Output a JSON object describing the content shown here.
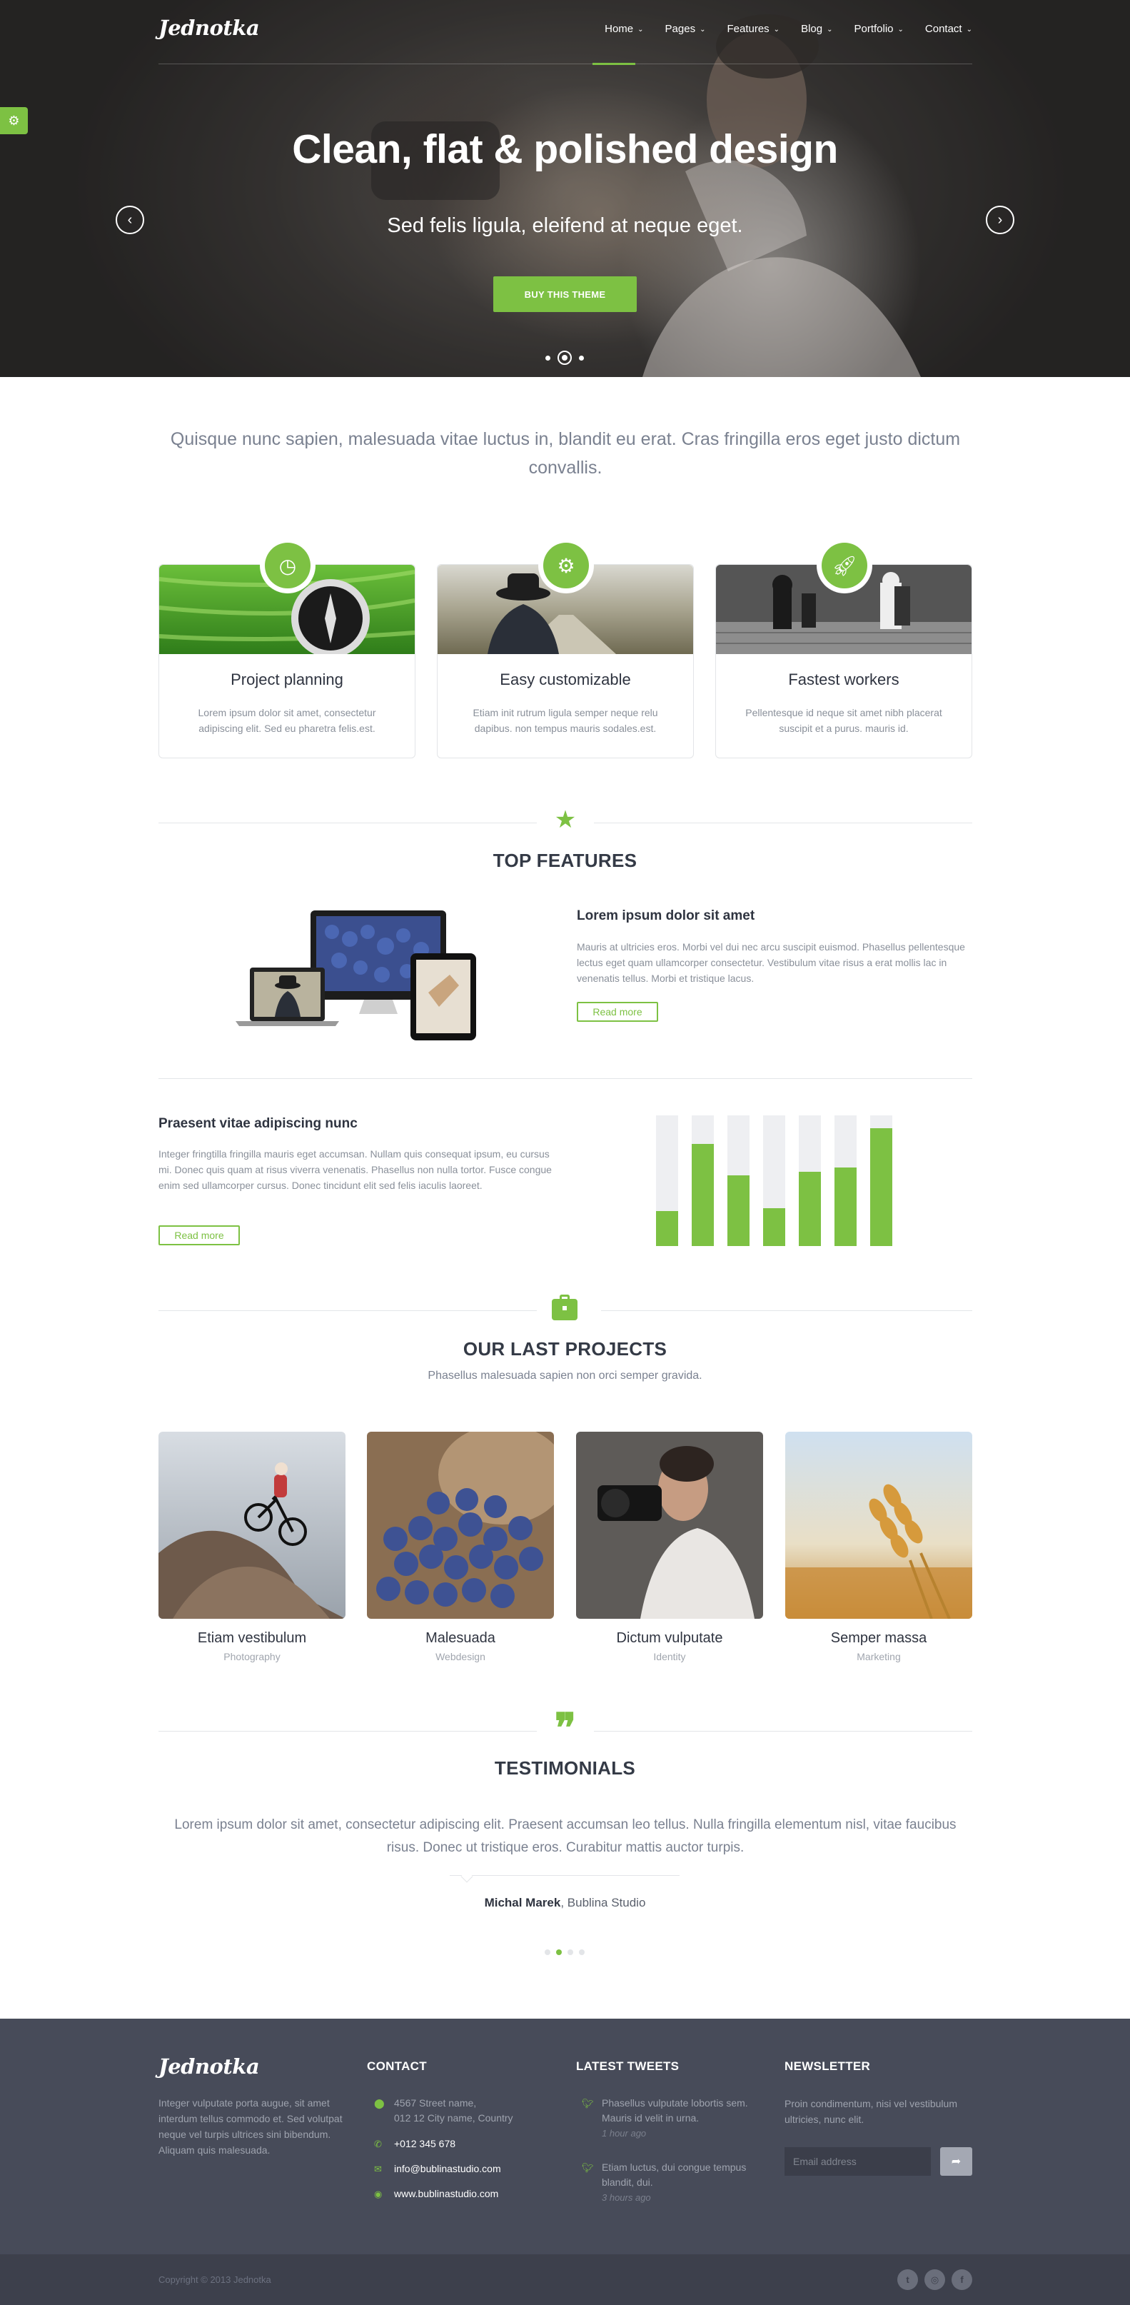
{
  "brand": {
    "logo_text": "Jednotka"
  },
  "nav": {
    "items": [
      {
        "label": "Home"
      },
      {
        "label": "Pages"
      },
      {
        "label": "Features"
      },
      {
        "label": "Blog"
      },
      {
        "label": "Portfolio"
      },
      {
        "label": "Contact"
      }
    ],
    "active_index": 0
  },
  "hero": {
    "title": "Clean, flat & polished design",
    "subtitle": "Sed felis ligula, eleifend at neque eget.",
    "button_label": "BUY THIS THEME",
    "slide_count": 3,
    "active_slide": 1
  },
  "intro": {
    "text": "Quisque nunc sapien, malesuada vitae luctus in, blandit eu erat. Cras fringilla eros eget justo dictum convallis."
  },
  "services": [
    {
      "icon": "clock-icon",
      "title": "Project planning",
      "text": "Lorem ipsum dolor sit amet, consectetur adipiscing elit. Sed eu pharetra felis.est."
    },
    {
      "icon": "gear-icon",
      "title": "Easy customizable",
      "text": "Etiam init rutrum ligula semper neque relu dapibus. non tempus mauris sodales.est."
    },
    {
      "icon": "rocket-icon",
      "title": "Fastest workers",
      "text": "Pellentesque id neque sit amet nibh placerat suscipit et a purus. mauris id."
    }
  ],
  "features": {
    "section_title": "TOP FEATURES",
    "section_icon": "star-icon",
    "feature1": {
      "title": "Lorem ipsum dolor sit amet",
      "text": "Mauris at ultricies eros. Morbi vel dui nec arcu suscipit euismod. Phasellus pellentesque lectus eget quam ullamcorper consectetur. Vestibulum vitae risus a erat mollis lac in venenatis tellus. Morbi et tristique lacus.",
      "button_label": "Read more"
    },
    "feature2": {
      "title": "Praesent vitae adipiscing nunc",
      "text": "Integer fringtilla fringilla mauris eget accumsan. Nullam quis consequat ipsum, eu cursus mi. Donec quis quam at risus viverra venenatis. Phasellus non nulla tortor. Fusce congue enim sed ullamcorper cursus. Donec tincidunt elit sed felis iaculis laoreet.",
      "button_label": "Read more"
    },
    "bars": [
      0.27,
      0.78,
      0.54,
      0.29,
      0.57,
      0.6,
      0.9
    ]
  },
  "projects": {
    "section_title": "OUR LAST PROJECTS",
    "section_icon": "briefcase-icon",
    "section_subtitle": "Phasellus malesuada sapien non orci semper gravida.",
    "items": [
      {
        "title": "Etiam vestibulum",
        "category": "Photography"
      },
      {
        "title": "Malesuada",
        "category": "Webdesign"
      },
      {
        "title": "Dictum vulputate",
        "category": "Identity"
      },
      {
        "title": "Semper massa",
        "category": "Marketing"
      }
    ]
  },
  "testimonials": {
    "section_title": "TESTIMONIALS",
    "section_icon": "quote-icon",
    "quote": "Lorem ipsum dolor sit amet, consectetur adipiscing elit. Praesent accumsan leo tellus. Nulla fringilla elementum nisl, vitae faucibus risus. Donec ut tristique eros. Curabitur mattis auctor turpis.",
    "author_name": "Michal Marek",
    "author_company": ", Bublina Studio",
    "dot_count": 4,
    "active_dot": 1
  },
  "footer": {
    "about_text": "Integer vulputate porta augue, sit amet interdum tellus commodo et. Sed volutpat neque vel turpis ultrices sini bibendum. Aliquam quis malesuada.",
    "contact": {
      "title": "CONTACT",
      "address_line1": "4567 Street name,",
      "address_line2": "012 12 City name, Country",
      "phone": "+012 345 678",
      "email": "info@bublinastudio.com",
      "website": "www.bublinastudio.com"
    },
    "tweets": {
      "title": "LATEST TWEETS",
      "items": [
        {
          "text": "Phasellus vulputate lobortis sem. Mauris id velit in urna.",
          "time": "1 hour ago"
        },
        {
          "text": "Etiam luctus, dui congue tempus blandit, dui.",
          "time": "3 hours ago"
        }
      ]
    },
    "newsletter": {
      "title": "NEWSLETTER",
      "text": "Proin condimentum, nisi vel vestibulum ultricies, nunc elit.",
      "email_placeholder": "Email address"
    },
    "copyright": "Copyright © 2013 Jednotka",
    "social": [
      "twitter-icon",
      "dribbble-icon",
      "facebook-icon"
    ]
  },
  "colors": {
    "accent": "#7dc143",
    "footer_bg": "#474b59",
    "subfooter_bg": "#3d404c",
    "text_dark": "#2f3440"
  }
}
